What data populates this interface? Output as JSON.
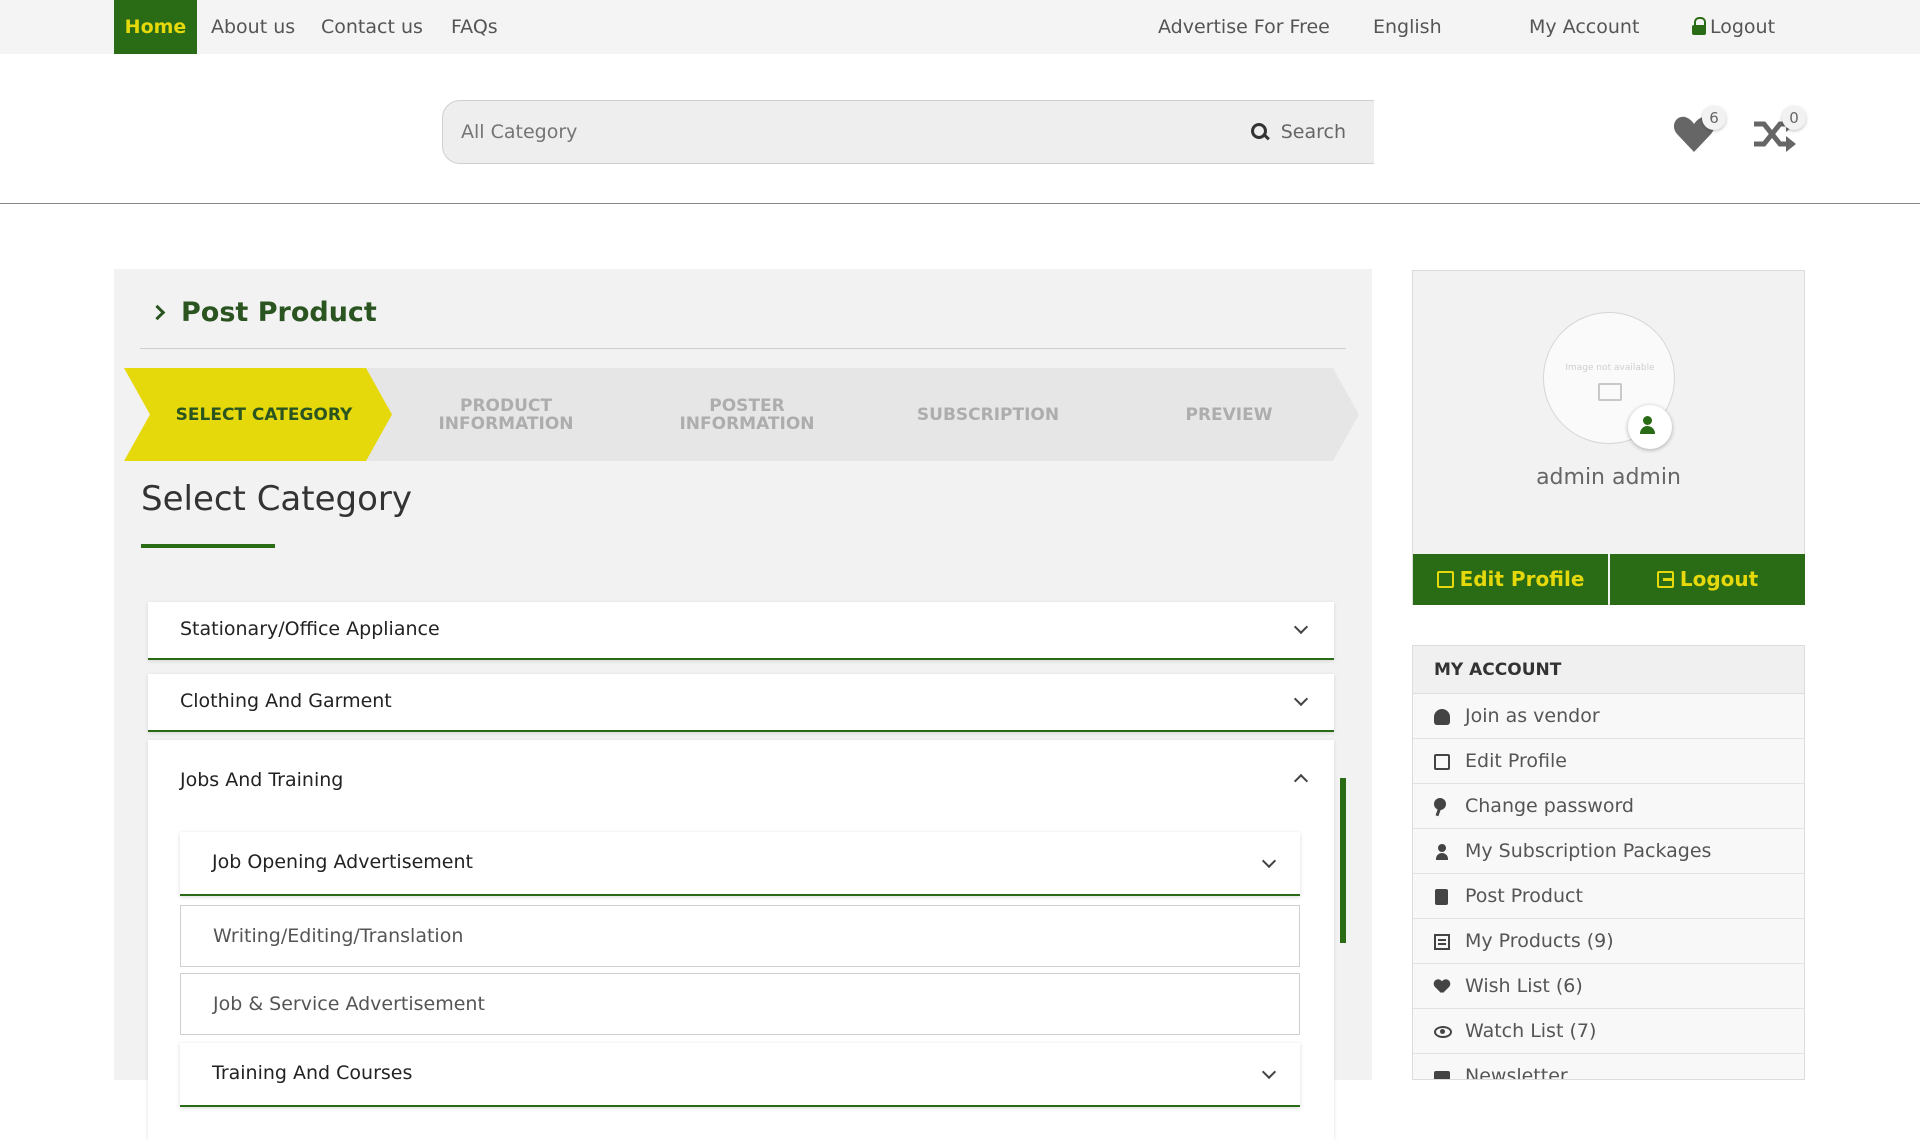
{
  "topnav": {
    "home": "Home",
    "about": "About us",
    "contact": "Contact us",
    "faqs": "FAQs",
    "advertise": "Advertise For Free",
    "language": "English",
    "account": "My Account",
    "logout": "Logout"
  },
  "header": {
    "search_placeholder": "All Category",
    "search_button": "Search",
    "wishlist_count": "6",
    "compare_count": "0"
  },
  "post_product": {
    "title": "Post Product",
    "steps": [
      {
        "label": "SELECT CATEGORY",
        "active": true
      },
      {
        "label": "PRODUCT INFORMATION",
        "active": false
      },
      {
        "label": "POSTER INFORMATION",
        "active": false
      },
      {
        "label": "SUBSCRIPTION",
        "active": false
      },
      {
        "label": "PREVIEW",
        "active": false
      }
    ],
    "section_title": "Select Category",
    "categories": [
      {
        "label": "Stationary/Office Appliance",
        "expanded": false
      },
      {
        "label": "Clothing And Garment",
        "expanded": false
      },
      {
        "label": "Jobs And Training",
        "expanded": true,
        "children": [
          {
            "label": "Job Opening Advertisement",
            "expandable": true
          },
          {
            "label": "Writing/Editing/Translation",
            "expandable": false
          },
          {
            "label": "Job & Service Advertisement",
            "expandable": false
          },
          {
            "label": "Training And Courses",
            "expandable": true
          }
        ]
      }
    ]
  },
  "profile": {
    "image_placeholder": "Image not available",
    "name": "admin admin",
    "edit_button": "Edit Profile",
    "logout_button": "Logout"
  },
  "my_account": {
    "heading": "MY ACCOUNT",
    "items": [
      {
        "label": "Join as vendor",
        "icon": "users-icon"
      },
      {
        "label": "Edit Profile",
        "icon": "edit-icon"
      },
      {
        "label": "Change password",
        "icon": "key-icon"
      },
      {
        "label": "My Subscription Packages",
        "icon": "user-icon"
      },
      {
        "label": "Post Product",
        "icon": "address-book-icon"
      },
      {
        "label": "My Products (9)",
        "icon": "list-icon"
      },
      {
        "label": "Wish List (6)",
        "icon": "heart-icon"
      },
      {
        "label": "Watch List (7)",
        "icon": "eye-icon"
      },
      {
        "label": "Newsletter",
        "icon": "envelope-icon"
      }
    ]
  },
  "colors": {
    "brand_green": "#2a6b16",
    "brand_yellow": "#e5d80b"
  }
}
